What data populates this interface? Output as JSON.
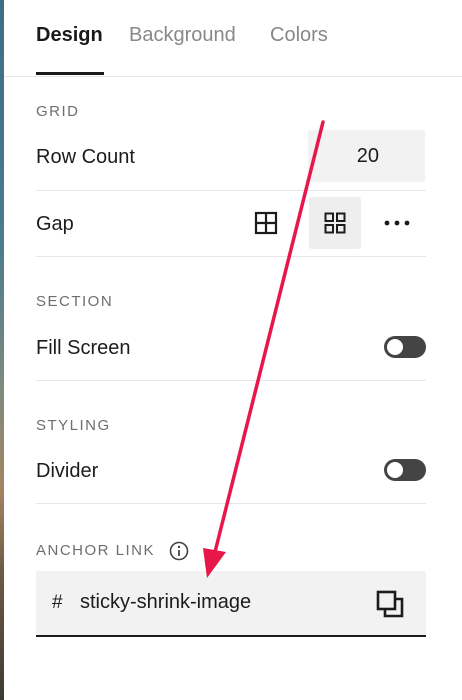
{
  "tabs": [
    {
      "label": "Design",
      "active": true
    },
    {
      "label": "Background",
      "active": false
    },
    {
      "label": "Colors",
      "active": false
    }
  ],
  "grid": {
    "section_label": "GRID",
    "row_count_label": "Row Count",
    "row_count_value": "20",
    "gap_label": "Gap",
    "gap_options": [
      {
        "icon": "grid-lines-icon",
        "selected": false
      },
      {
        "icon": "grid-spaced-icon",
        "selected": true
      }
    ],
    "more_icon": "more-horizontal-icon"
  },
  "section": {
    "section_label": "SECTION",
    "fill_screen_label": "Fill Screen",
    "fill_screen_on": false
  },
  "styling": {
    "section_label": "STYLING",
    "divider_label": "Divider",
    "divider_on": false
  },
  "anchor": {
    "section_label": "ANCHOR LINK",
    "info_icon": "info-icon",
    "hash": "#",
    "value": "sticky-shrink-image",
    "copy_icon": "copy-icon"
  },
  "colors": {
    "arrow": "#e8174a",
    "toggle_off": "#444444",
    "input_bg": "#f2f2f2"
  }
}
